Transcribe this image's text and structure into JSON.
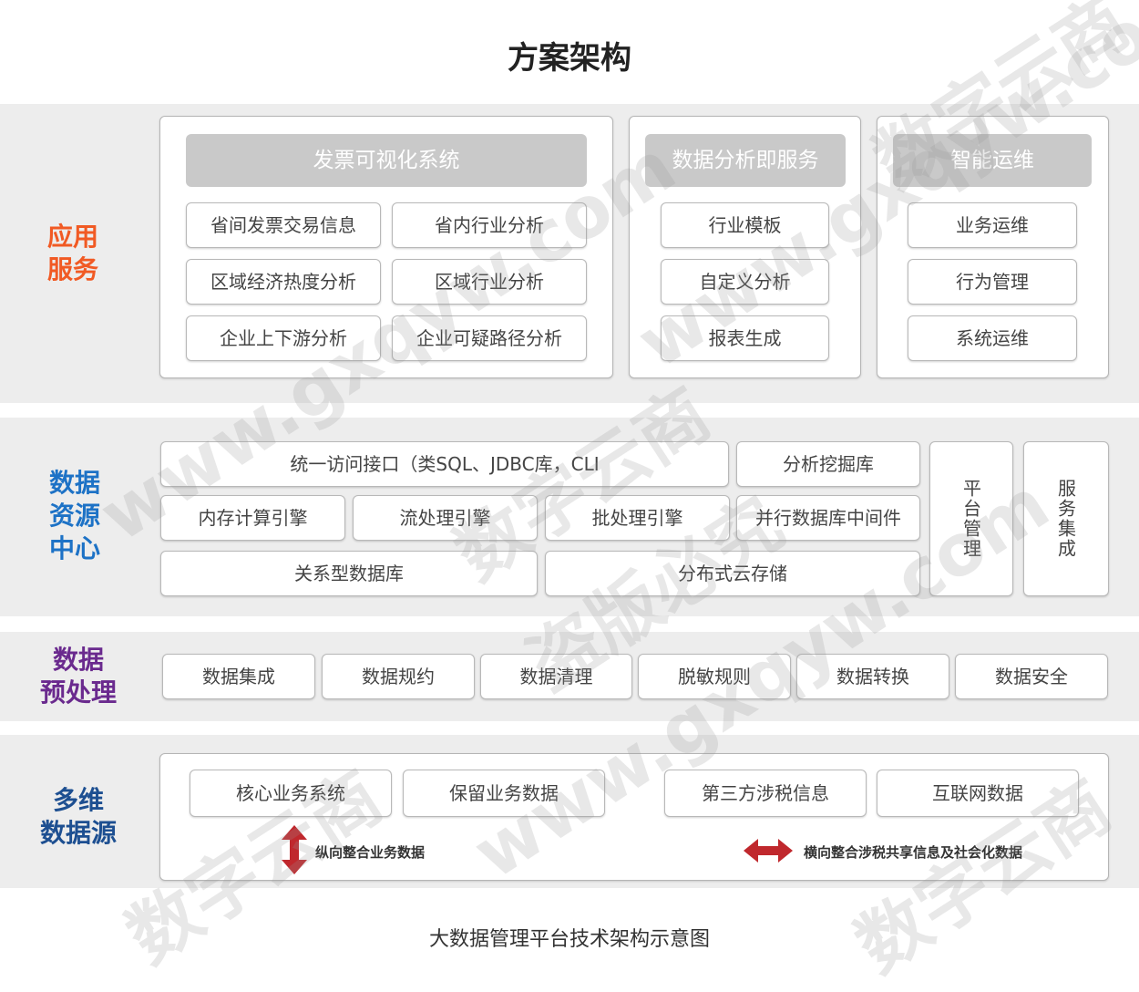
{
  "title": "方案架构",
  "caption": "大数据管理平台技术架构示意图",
  "colors": {
    "app": "#f15a24",
    "resource": "#1d72c6",
    "preprocess": "#6a2a8e",
    "source": "#1d4f91",
    "arrow": "#c0282d"
  },
  "app_layer": {
    "label_line1": "应用",
    "label_line2": "服务",
    "invoice_panel": {
      "header": "发票可视化系统",
      "items": [
        "省间发票交易信息",
        "省内行业分析",
        "区域经济热度分析",
        "区域行业分析",
        "企业上下游分析",
        "企业可疑路径分析"
      ]
    },
    "analysis_panel": {
      "header": "数据分析即服务",
      "items": [
        "行业模板",
        "自定义分析",
        "报表生成"
      ]
    },
    "ops_panel": {
      "header": "智能运维",
      "items": [
        "业务运维",
        "行为管理",
        "系统运维"
      ]
    }
  },
  "resource_layer": {
    "label_line1": "数据",
    "label_line2": "资源",
    "label_line3": "中心",
    "unified_access": "统一访问接口（类SQL、JDBC库，CLI",
    "mining_lib": "分析挖掘库",
    "memory_engine": "内存计算引擎",
    "stream_engine": "流处理引擎",
    "batch_engine": "批处理引擎",
    "parallel_db": "并行数据库中间件",
    "relational_db": "关系型数据库",
    "cloud_storage": "分布式云存储",
    "platform_mgmt": "平台管理",
    "service_integration": "服务集成"
  },
  "preprocess_layer": {
    "label_line1": "数据",
    "label_line2": "预处理",
    "items": [
      "数据集成",
      "数据规约",
      "数据清理",
      "脱敏规则",
      "数据转换",
      "数据安全"
    ]
  },
  "source_layer": {
    "label_line1": "多维",
    "label_line2": "数据源",
    "items": [
      "核心业务系统",
      "保留业务数据",
      "第三方涉税信息",
      "互联网数据"
    ],
    "vertical_note": "纵向整合业务数据",
    "horizontal_note": "横向整合涉税共享信息及社会化数据"
  },
  "watermarks": [
    "数字云商",
    "www.gxqyw.com",
    "盗版必究"
  ]
}
